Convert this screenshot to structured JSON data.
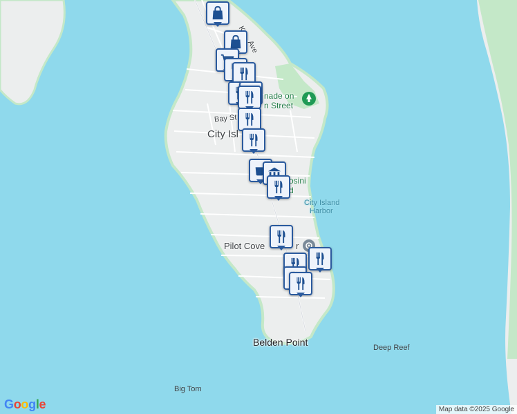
{
  "colors": {
    "water": "#8fd9ec",
    "land": "#eceeee",
    "park": "#c4e8c8",
    "pin_border": "#2a5a9e",
    "pin_fill": "#eef3fb",
    "icon": "#1d4f91"
  },
  "labels": {
    "city_island": "City Isl",
    "bay_st": "Bay St",
    "kings_ave": "K",
    "ave_fragment": "Ave",
    "promenade_1": "nade on",
    "promenade_2": "n Street",
    "tosini_1": "osini",
    "tosini_2": "d",
    "harbor_1": "City Island",
    "harbor_2": "Harbor",
    "pilot_cove": "Pilot Cove",
    "pilot_cove_tail": "r",
    "belden_point": "Belden Point",
    "deep_reef": "Deep Reef",
    "big_tom": "Big Tom"
  },
  "logo": {
    "letters": [
      "G",
      "o",
      "o",
      "g",
      "l",
      "e"
    ],
    "colors": [
      "#4285f4",
      "#ea4335",
      "#fbbc05",
      "#4285f4",
      "#34a853",
      "#ea4335"
    ]
  },
  "attribution": "Map data ©2025 Google",
  "markers": [
    {
      "type": "shopping",
      "icon": "shopping-bag-icon"
    },
    {
      "type": "shopping",
      "icon": "shopping-bag-icon"
    },
    {
      "type": "grocery",
      "icon": "shopping-cart-icon"
    },
    {
      "type": "restaurant",
      "icon": "fork-knife-icon"
    },
    {
      "type": "restaurant",
      "icon": "fork-knife-icon"
    },
    {
      "type": "restaurant",
      "icon": "fork-knife-icon"
    },
    {
      "type": "shopping",
      "icon": "shopping-bag-icon"
    },
    {
      "type": "restaurant",
      "icon": "fork-knife-icon"
    },
    {
      "type": "restaurant",
      "icon": "fork-knife-icon"
    },
    {
      "type": "restaurant",
      "icon": "fork-knife-icon"
    },
    {
      "type": "cafe",
      "icon": "coffee-cup-icon"
    },
    {
      "type": "museum",
      "icon": "museum-icon"
    },
    {
      "type": "restaurant",
      "icon": "fork-knife-icon"
    },
    {
      "type": "restaurant",
      "icon": "fork-knife-icon"
    },
    {
      "type": "restaurant",
      "icon": "fork-knife-icon"
    },
    {
      "type": "restaurant",
      "icon": "fork-knife-icon"
    },
    {
      "type": "restaurant",
      "icon": "fork-knife-icon"
    },
    {
      "type": "restaurant",
      "icon": "fork-knife-icon"
    }
  ]
}
